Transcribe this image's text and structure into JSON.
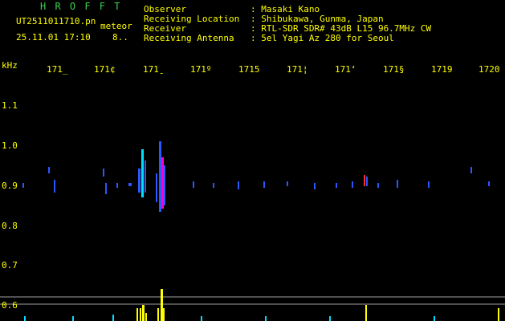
{
  "header": {
    "brand": "H R O F F T",
    "filename": "UT2511011710.pn",
    "meteor_label": "meteor",
    "datetime": "25.11.01 17:10",
    "counter": "8..",
    "info_labels": [
      "Observer",
      "Receiving Location",
      "Receiver",
      "Receiving Antenna"
    ],
    "info_values": [
      ": Masaki Kano",
      ": Shibukawa, Gunma, Japan",
      ": RTL-SDR SDR# 43dB L15 96.7MHz CW",
      ": 5el Yagi Az 280 for Seoul"
    ]
  },
  "axis": {
    "unit": "kHz",
    "top_ticks": [
      "171_",
      "171¢",
      "171̱",
      "171º",
      "1715",
      "171¦",
      "171ʻ",
      "171§",
      "1719",
      "1720"
    ],
    "left_ticks": [
      "1.1",
      "1.0",
      "0.9",
      "0.8",
      "0.7",
      "0.6"
    ]
  },
  "colors": {
    "text": "#ffff00",
    "brand": "#39d24a",
    "grid": "#a0a0a0",
    "signal_blue": "#2a57ff",
    "signal_cyan": "#00e0ff",
    "signal_red": "#ff2a2a",
    "signal_magenta": "#ff00c8"
  },
  "chart_data": {
    "type": "heatmap",
    "y_axis_label": "kHz",
    "y_ticks": [
      1.1,
      1.0,
      0.9,
      0.8,
      0.7,
      0.6
    ],
    "baseline_frequency_khz": 0.9,
    "meteor_event_column": "1713",
    "bottom_peaks": [
      0.62,
      0.58,
      0.61,
      0.59,
      0.63
    ]
  }
}
